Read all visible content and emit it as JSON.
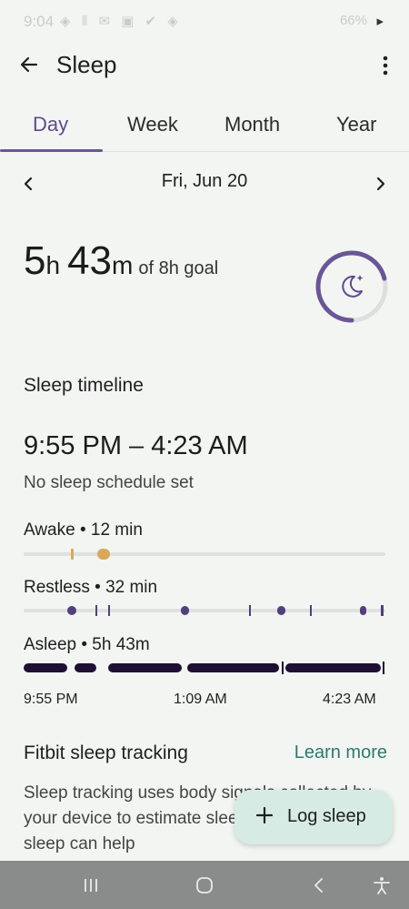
{
  "status_bar": {
    "time": "9:04",
    "right": "66%"
  },
  "app_bar": {
    "title": "Sleep",
    "back_icon": "arrow-left-icon",
    "more_icon": "more-vert-icon"
  },
  "tabs": [
    {
      "label": "Day",
      "active": true
    },
    {
      "label": "Week",
      "active": false
    },
    {
      "label": "Month",
      "active": false
    },
    {
      "label": "Year",
      "active": false
    }
  ],
  "date_nav": {
    "date": "Fri, Jun 20"
  },
  "summary": {
    "hours": "5",
    "hours_unit": "h",
    "minutes": "43",
    "minutes_unit": "m",
    "goal_text": "of 8h goal",
    "progress": 0.71,
    "ring_color": "#6a5597"
  },
  "timeline": {
    "title": "Sleep timeline",
    "range": "9:55 PM – 4:23 AM",
    "schedule": "No sleep schedule set",
    "stages": [
      {
        "label": "Awake • 12 min",
        "color": "#d9a95a"
      },
      {
        "label": "Restless • 32 min",
        "color": "#51407a"
      },
      {
        "label": "Asleep • 5h 43m",
        "color": "#1e0f33"
      }
    ],
    "time_labels": [
      "9:55 PM",
      "1:09 AM",
      "4:23 AM"
    ]
  },
  "fitbit": {
    "title": "Fitbit sleep tracking",
    "learn_more": "Learn more",
    "body": "Sleep tracking uses body signals collected by your device to estimate sleep metrics. Tracking sleep can help"
  },
  "fab": {
    "label": "Log sleep"
  }
}
